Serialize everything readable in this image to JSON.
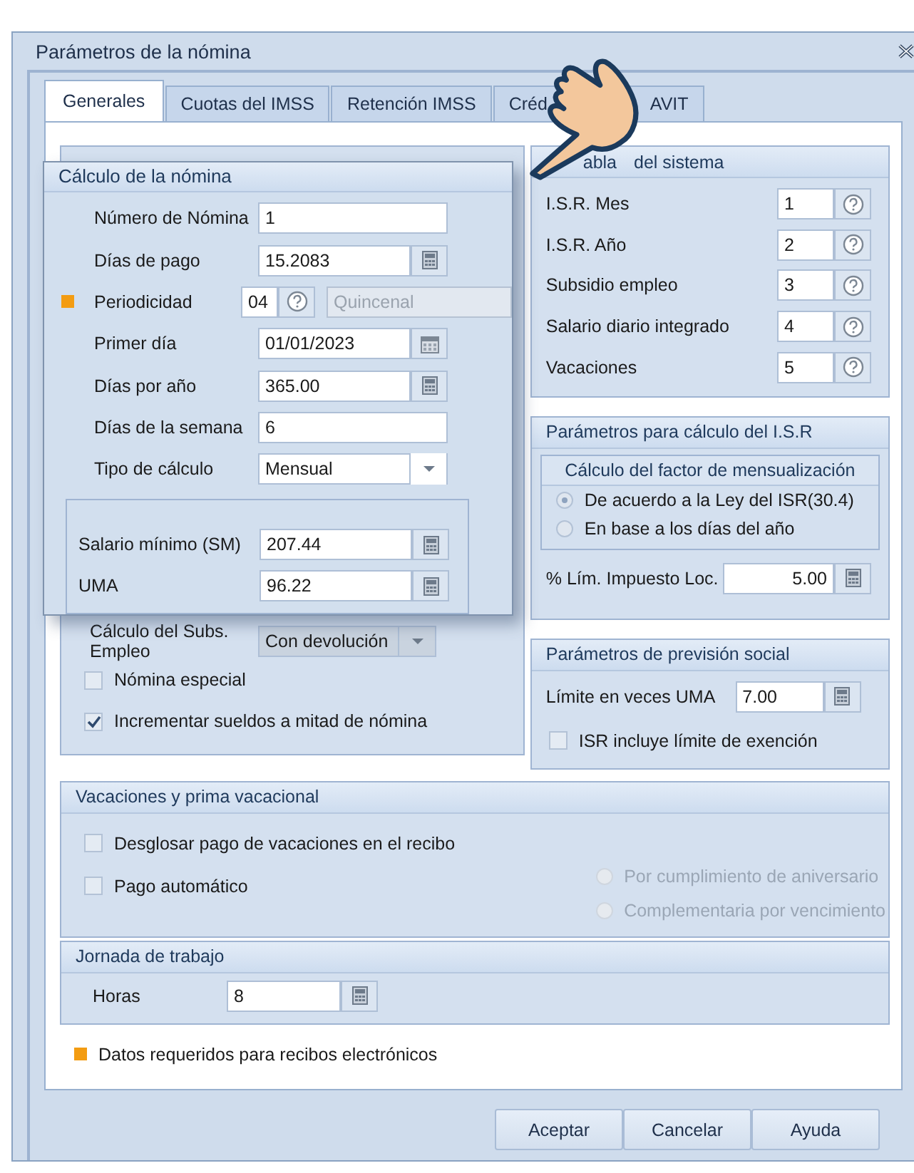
{
  "window": {
    "title": "Parámetros de la nómina"
  },
  "tabs": [
    {
      "label": "Generales",
      "selected": true
    },
    {
      "label": "Cuotas del IMSS",
      "selected": false
    },
    {
      "label": "Retención IMSS",
      "selected": false
    },
    {
      "label": "Créd",
      "label_end": "AVIT",
      "selected": false
    }
  ],
  "payroll_group": {
    "subsidy": {
      "label": "Cálculo del Subs. Empleo",
      "value": "Con devolución"
    },
    "checkboxes": [
      {
        "label": "Nómina especial",
        "checked": false
      },
      {
        "label": "Incrementar sueldos a mitad de nómina",
        "checked": true
      }
    ]
  },
  "popup": {
    "title": "Cálculo de la nómina",
    "fields": [
      {
        "kind": "text",
        "label": "Número de Nómina",
        "value": "1"
      },
      {
        "kind": "calc",
        "label": "Días de pago",
        "value": "15.2083"
      },
      {
        "kind": "code",
        "label": "Periodicidad",
        "value": "04",
        "description": "Quincenal",
        "required": true
      },
      {
        "kind": "date",
        "label": "Primer día",
        "value": "01/01/2023"
      },
      {
        "kind": "calc",
        "label": "Días por año",
        "value": "365.00"
      },
      {
        "kind": "text",
        "label": "Días de la semana",
        "value": "6"
      },
      {
        "kind": "select",
        "label": "Tipo de cálculo",
        "value": "Mensual"
      }
    ],
    "subgroup": [
      {
        "kind": "calc",
        "label": "Salario mínimo (SM)",
        "value": "207.44"
      },
      {
        "kind": "calc",
        "label": "UMA",
        "value": "96.22"
      }
    ]
  },
  "tables": {
    "title_parts": [
      "abla",
      "del sistema"
    ],
    "rows": [
      {
        "label": "I.S.R. Mes",
        "value": "1"
      },
      {
        "label": "I.S.R. Año",
        "value": "2"
      },
      {
        "label": "Subsidio empleo",
        "value": "3"
      },
      {
        "label": "Salario diario integrado",
        "value": "4"
      },
      {
        "label": "Vacaciones",
        "value": "5"
      }
    ]
  },
  "isr": {
    "title": "Parámetros para cálculo del I.S.R",
    "subtitle": "Cálculo del factor de mensualización",
    "options": [
      {
        "label": "De acuerdo a la Ley del ISR(30.4)",
        "selected": true
      },
      {
        "label": "En base a los días del año",
        "selected": false
      }
    ],
    "limit": {
      "label": "% Lím. Impuesto Loc.",
      "value": "5.00"
    }
  },
  "social": {
    "title": "Parámetros de previsión social",
    "limit": {
      "label": "Límite en veces UMA",
      "value": "7.00"
    },
    "checkbox": {
      "label": "ISR incluye límite de exención",
      "checked": false
    }
  },
  "vacations": {
    "title": "Vacaciones y prima vacacional",
    "checkboxes": [
      {
        "label": "Desglosar pago de vacaciones en el recibo",
        "checked": false
      },
      {
        "label": "Pago automático",
        "checked": false
      }
    ],
    "options": [
      {
        "label": "Por cumplimiento de aniversario",
        "selected": false,
        "disabled": true
      },
      {
        "label": "Complementaria por vencimiento",
        "selected": false,
        "disabled": true
      }
    ]
  },
  "workday": {
    "title": "Jornada de trabajo",
    "label": "Horas",
    "value": "8"
  },
  "legend": "Datos requeridos para recibos electrónicos",
  "buttons": [
    "Aceptar",
    "Cancelar",
    "Ayuda"
  ]
}
